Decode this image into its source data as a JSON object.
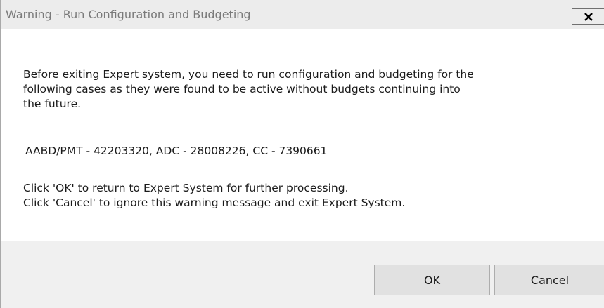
{
  "dialog": {
    "title": "Warning - Run Configuration and Budgeting",
    "close_glyph": "X",
    "message": {
      "line1": "Before exiting Expert system, you need to run configuration and budgeting for the",
      "line2": "following cases as they were found to be active without budgets continuing into",
      "line3": "the future.",
      "cases": "AABD/PMT - 42203320, ADC - 28008226, CC - 7390661",
      "ok_hint": "Click 'OK' to return to Expert System for further processing.",
      "cancel_hint": "Click 'Cancel' to ignore this warning message and exit Expert System."
    },
    "buttons": {
      "ok": "OK",
      "cancel": "Cancel"
    }
  },
  "icons": {
    "close": "close-icon"
  }
}
